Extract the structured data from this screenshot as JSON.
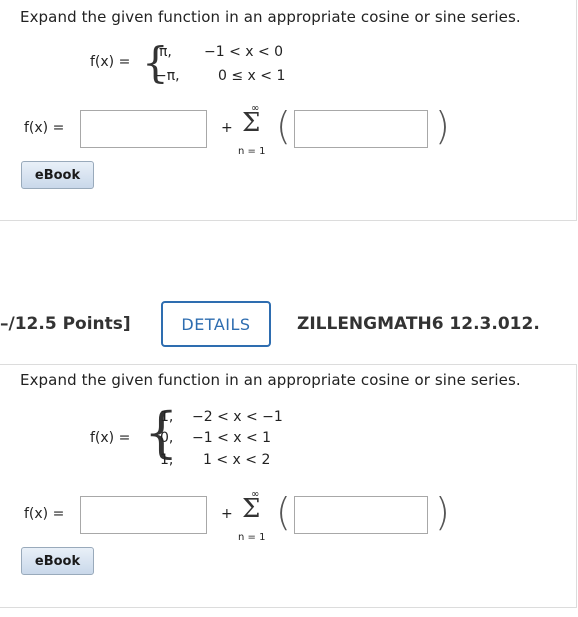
{
  "q1": {
    "instruction": "Expand the given function in an appropriate cosine or sine series.",
    "fx_label": "f(x) =",
    "cases": [
      {
        "value": "π,",
        "condition": "−1 < x < 0"
      },
      {
        "value": "−π,",
        "condition": "0 ≤ x < 1"
      }
    ],
    "answer_label": "f(x) =",
    "plus": "+",
    "sum_top": "∞",
    "sum_symbol": "Σ",
    "sum_bottom": "n = 1",
    "ebook_label": "eBook"
  },
  "header": {
    "points": "–/12.5 Points]",
    "details_label": "DETAILS",
    "problem_id": "ZILLENGMATH6 12.3.012."
  },
  "q2": {
    "instruction": "Expand the given function in an appropriate cosine or sine series.",
    "fx_label": "f(x) =",
    "cases": [
      {
        "value": "1,",
        "condition": "−2 < x < −1"
      },
      {
        "value": "0,",
        "condition": "−1 < x < 1"
      },
      {
        "value": "1,",
        "condition": "1 < x < 2"
      }
    ],
    "answer_label": "f(x) =",
    "plus": "+",
    "sum_top": "∞",
    "sum_symbol": "Σ",
    "sum_bottom": "n = 1",
    "ebook_label": "eBook"
  }
}
